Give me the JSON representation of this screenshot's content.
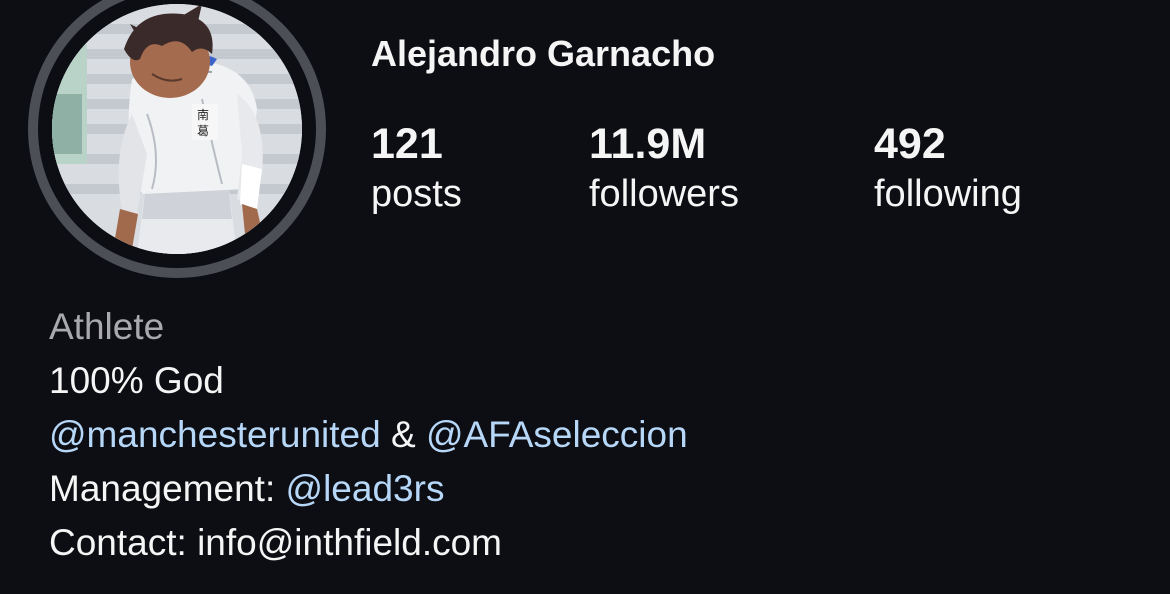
{
  "profile": {
    "name": "Alejandro Garnacho",
    "avatar_icon": "profile-avatar-anime-image",
    "ring_color": "#4c4f56",
    "background_color": "#0d0e14"
  },
  "stats": {
    "posts": {
      "count": "121",
      "label": "posts"
    },
    "followers": {
      "count": "11.9M",
      "label": "followers"
    },
    "following": {
      "count": "492",
      "label": "following"
    }
  },
  "bio": {
    "category": "Athlete",
    "line1": "100% God",
    "mention1": "@manchesterunited",
    "amp": " & ",
    "mention2": "@AFAseleccion",
    "management_prefix": "Management: ",
    "management_handle": "@lead3rs",
    "contact": "Contact: info@inthfield.com",
    "link_color": "#b6d7f7"
  }
}
